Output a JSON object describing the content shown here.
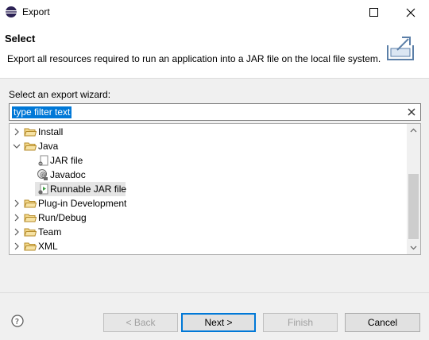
{
  "window": {
    "title": "Export"
  },
  "header": {
    "title": "Select",
    "description": "Export all resources required to run an application into a JAR file on the local file system."
  },
  "wizard": {
    "label": "Select an export wizard:",
    "filter_placeholder": "type filter text",
    "filter_value": "type filter text"
  },
  "tree": {
    "items": [
      {
        "label": "Install",
        "expanded": false,
        "level": 0,
        "icon": "folder-icon"
      },
      {
        "label": "Java",
        "expanded": true,
        "level": 0,
        "icon": "folder-icon"
      },
      {
        "label": "JAR file",
        "level": 1,
        "icon": "jar-file-icon"
      },
      {
        "label": "Javadoc",
        "level": 1,
        "icon": "javadoc-icon"
      },
      {
        "label": "Runnable JAR file",
        "level": 1,
        "icon": "runnable-jar-icon",
        "selected": true
      },
      {
        "label": "Plug-in Development",
        "expanded": false,
        "level": 0,
        "icon": "folder-icon"
      },
      {
        "label": "Run/Debug",
        "expanded": false,
        "level": 0,
        "icon": "folder-icon"
      },
      {
        "label": "Team",
        "expanded": false,
        "level": 0,
        "icon": "folder-icon"
      },
      {
        "label": "XML",
        "expanded": false,
        "level": 0,
        "icon": "folder-icon"
      }
    ]
  },
  "buttons": {
    "back": "< Back",
    "next": "Next >",
    "finish": "Finish",
    "cancel": "Cancel"
  },
  "colors": {
    "selection": "#0078d7",
    "folder": "#e8c15a",
    "selected_row": "#e5e5e5"
  }
}
